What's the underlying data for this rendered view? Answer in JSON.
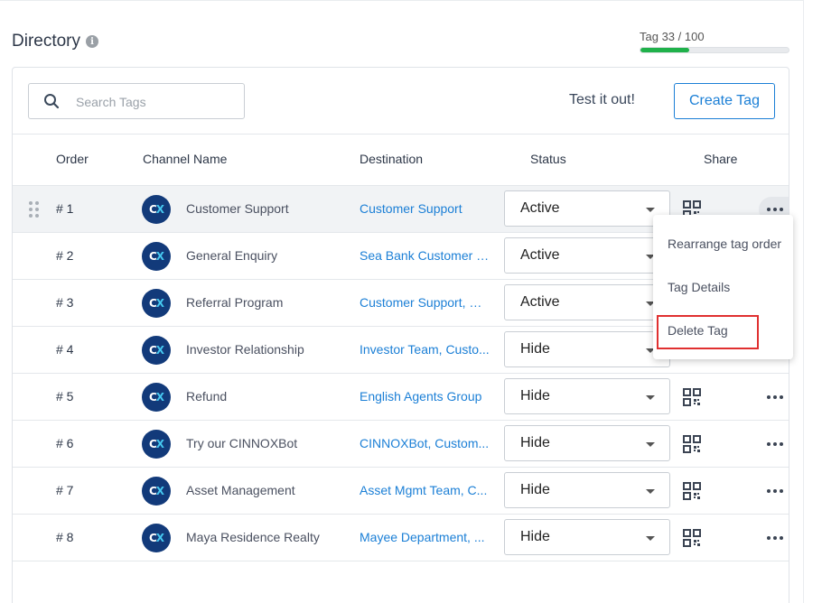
{
  "header": {
    "title": "Directory",
    "info_icon": "info-icon"
  },
  "tag_usage": {
    "label": "Tag 33 / 100",
    "used": 33,
    "limit": 100,
    "bar_color": "#1fb14a"
  },
  "toolbar": {
    "search_placeholder": "Search Tags",
    "search_value": "",
    "test_label": "Test it out!",
    "create_label": "Create Tag"
  },
  "columns": {
    "order": "Order",
    "channel": "Channel Name",
    "destination": "Destination",
    "status": "Status",
    "share": "Share"
  },
  "rows": [
    {
      "order": "# 1",
      "channel": "Customer Support",
      "destination": "Customer Support",
      "status": "Active"
    },
    {
      "order": "# 2",
      "channel": "General Enquiry",
      "destination": "Sea Bank Customer S...",
      "status": "Active"
    },
    {
      "order": "# 3",
      "channel": "Referral Program",
      "destination": "Customer Support, Gr...",
      "status": "Active"
    },
    {
      "order": "# 4",
      "channel": "Investor Relationship",
      "destination": "Investor Team, Custo...",
      "status": "Hide"
    },
    {
      "order": "# 5",
      "channel": "Refund",
      "destination": "English Agents Group",
      "status": "Hide"
    },
    {
      "order": "# 6",
      "channel": "Try our CINNOXBot",
      "destination": "CINNOXBot, Custom...",
      "status": "Hide"
    },
    {
      "order": "# 7",
      "channel": "Asset Management",
      "destination": "Asset Mgmt Team, C...",
      "status": "Hide"
    },
    {
      "order": "# 8",
      "channel": "Maya Residence Realty",
      "destination": "Mayee Department, ...",
      "status": "Hide"
    }
  ],
  "context_menu": {
    "items": [
      "Rearrange tag order",
      "Tag Details",
      "Delete Tag"
    ],
    "highlight_color": "#e03030"
  },
  "colors": {
    "accent": "#1b7fd6",
    "avatar_bg": "#123a7a",
    "avatar_x": "#46c8f0"
  }
}
